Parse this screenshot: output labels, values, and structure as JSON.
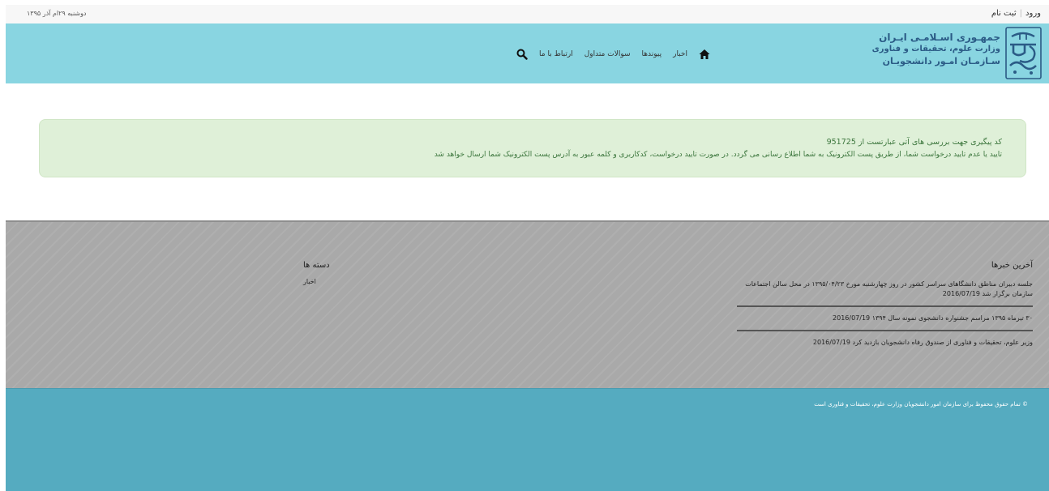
{
  "topbar": {
    "login": "ورود",
    "separator": "|",
    "register": "ثبت نام",
    "date": "دوشنبه ۲۹ام آذر ۱۳۹۵"
  },
  "logo": {
    "line1": "جمهـوری اسـلامـی ایـران",
    "line2": "وزارت علوم، تحقیقات و فناوری",
    "line3": "سـازمـان امـور دانشجویـان"
  },
  "nav": {
    "home_icon": "home-icon",
    "items": [
      "اخبار",
      "پیوندها",
      "سوالات متداول",
      "ارتباط با ما"
    ],
    "search_icon": "search-icon"
  },
  "alert": {
    "line1": "کد پیگیری جهت بررسی های آتی عبارتست از 951725",
    "line2": "تایید یا عدم تایید درخواست شما، از طریق پست الکترونیک به شما اطلاع رسانی می گردد. در صورت تایید درخواست، کدکاربری و کلمه عبور به آدرس پست الکترونیک شما ارسال خواهد شد"
  },
  "footer": {
    "news_title": "آخرین خبرها",
    "news": [
      {
        "text": "جلسه دبیران مناطق دانشگاهای سراسر کشور در روز چهارشنبه مورخ ۱۳۹۵/۰۴/۲۳ در محل سالن اجتماعات سازمان برگزار شد",
        "date": "2016/07/19"
      },
      {
        "text": "۳۰ تیرماه ۱۳۹۵ مراسم جشنواره دانشجوی نمونه سال ۱۳۹۴",
        "date": "2016/07/19"
      },
      {
        "text": "وزیر علوم، تحقیقات و فناوری از صندوق رفاه دانشجویان بازدید کرد",
        "date": "2016/07/19"
      }
    ],
    "categories_title": "دسته ها",
    "categories": [
      "اخبار"
    ],
    "copyright": "© تمام حقوق محفوظ برای سازمان امور دانشجویان وزارت علوم، تحقیقات و فناوری است"
  },
  "colors": {
    "header_bg": "#89d5e1",
    "alert_bg": "#dff0d8",
    "alert_text": "#3c763d",
    "footer_bg": "#a9a9a9",
    "bottom_bg": "#55abc0",
    "logo_text": "#2b5b86"
  }
}
